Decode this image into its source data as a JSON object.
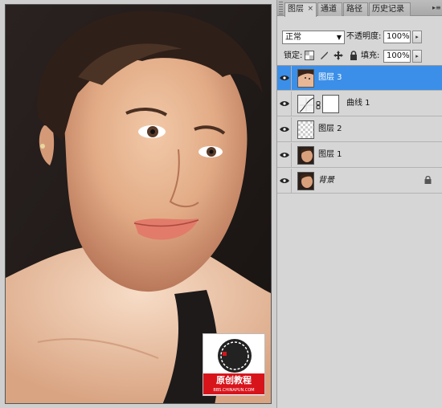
{
  "panel": {
    "tabs": [
      {
        "label": "图层",
        "active": true,
        "close": "×"
      },
      {
        "label": "通道",
        "active": false
      },
      {
        "label": "路径",
        "active": false
      },
      {
        "label": "历史记录",
        "active": false
      }
    ],
    "menu_glyph": "▸≡",
    "blend_mode": "正常",
    "blend_arrow": "▼",
    "opacity_label": "不透明度:",
    "opacity_value": "100%",
    "lock_label": "锁定:",
    "fill_label": "填充:",
    "fill_value": "100%",
    "spin_glyph": "▸"
  },
  "layers": [
    {
      "name": "图层 3",
      "selected": true,
      "thumb": "photo"
    },
    {
      "name": "曲线 1",
      "selected": false,
      "thumb": "curves"
    },
    {
      "name": "图层 2",
      "selected": false,
      "thumb": "transparent"
    },
    {
      "name": "图层 1",
      "selected": false,
      "thumb": "photo"
    },
    {
      "name": "背景",
      "selected": false,
      "thumb": "photo",
      "italic": true,
      "locked": true
    }
  ],
  "watermark": {
    "seal_chars": "中国",
    "title": "原创教程",
    "url": "BBS.CHINAPUN.COM"
  },
  "colors": {
    "selection": "#3b8fe8",
    "panel_bg": "#d6d6d6",
    "watermark_red": "#d8141b"
  }
}
